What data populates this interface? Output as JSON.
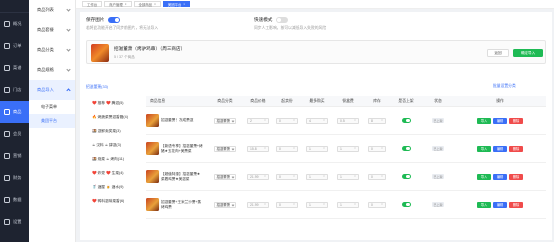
{
  "sidebar_primary": [
    {
      "label": "概况",
      "icon": "dashboard-icon"
    },
    {
      "label": "订单",
      "icon": "order-icon"
    },
    {
      "label": "菜谱",
      "icon": "recipe-icon"
    },
    {
      "label": "门店",
      "icon": "store-icon"
    },
    {
      "label": "商品",
      "icon": "goods-icon",
      "active": true
    },
    {
      "label": "会员",
      "icon": "member-icon"
    },
    {
      "label": "营销",
      "icon": "marketing-icon"
    },
    {
      "label": "财务",
      "icon": "finance-icon"
    },
    {
      "label": "数据",
      "icon": "data-icon"
    },
    {
      "label": "设置",
      "icon": "settings-icon"
    }
  ],
  "sidebar_secondary": {
    "items": [
      {
        "label": "商品列表"
      },
      {
        "label": "商品套餐"
      },
      {
        "label": "商品分类"
      },
      {
        "label": "商品规格"
      },
      {
        "label": "商品导入",
        "open": true
      }
    ],
    "sub": [
      {
        "label": "电子菜单"
      },
      {
        "label": "美团平台",
        "active": true
      }
    ]
  },
  "tabs": [
    {
      "label": "工作台"
    },
    {
      "label": "商户管理"
    },
    {
      "label": "全部商品"
    },
    {
      "label": "美团平台",
      "active": true
    }
  ],
  "options": {
    "sync_image": {
      "title": "保存图片",
      "desc": "若将此功能开启了同步前图片，将无法导入"
    },
    "quick_mode": {
      "title": "快速模式",
      "desc": "同步人工影响，按可以减低导入失败的风险"
    }
  },
  "product": {
    "name": "招滋董萧（烤驴鸡串）（周三商店）",
    "sub": "5 / 37 个商品",
    "back": "返回",
    "confirm": "确定导入"
  },
  "category_header": "招滋董萧(33)",
  "batch_action": "批量设置分类",
  "categories": [
    "❤️ 推荐 ❤️ 腾滋(5)",
    "🔥 烤蔬菜萧滋香腊(4)",
    "🍱 滋鲜卖类菜(3)",
    "☕ 汉料 ☕ 肆滋(3)",
    "🍱 烧菜 ☕ 烤肉(11)",
    "❤️ 炸党 ❤️ 生菜(4)",
    "🥤 酒屋 🍺 酒水(9)",
    "❤️ 鸭料滋味菜香(6)"
  ],
  "table": {
    "headers": [
      "商品信息",
      "商品分类",
      "商品价格",
      "起卖份",
      "最多购买",
      "餐盒费",
      "库存",
      "是否上架",
      "状态",
      "操作"
    ],
    "rows": [
      {
        "name": "招滋董萧！冻成萧滋",
        "cat": "招滋董萧",
        "price": "2",
        "min": "0",
        "max": "4",
        "box": "0.5",
        "stock": "8",
        "status_on": true,
        "tag": "已上架",
        "ops": [
          "导入",
          "编辑",
          "删除"
        ]
      },
      {
        "name": "【新语专享】招滋董萧+烤猪★五花肉+美萧菜",
        "cat": "招滋董萧",
        "price": "15.8",
        "min": "0",
        "max": "1",
        "box": "1",
        "stock": "0",
        "status_on": true,
        "tag": "已上架",
        "ops": [
          "导入",
          "编辑",
          "删除"
        ]
      },
      {
        "name": "【超值特惠】招滋董萧★ 菜着鸡萧★美滋菜",
        "cat": "招滋董萧",
        "price": "21.99",
        "min": "0",
        "max": "1",
        "box": "1",
        "stock": "0",
        "status_on": true,
        "tag": "已上架",
        "ops": [
          "导入",
          "编辑",
          "删除"
        ]
      },
      {
        "name": "招滋董萧+王米兰沙萧+蒸烤鸡萧",
        "cat": "招滋董萧",
        "price": "21.99",
        "min": "0",
        "max": "1",
        "box": "1",
        "stock": "0",
        "status_on": true,
        "tag": "已上架",
        "ops": [
          "导入",
          "编辑",
          "删除"
        ]
      }
    ]
  },
  "colors": {
    "accent": "#3a6ff7",
    "success": "#1eba54",
    "danger": "#f04b4b",
    "sidebar": "#1e2330"
  }
}
